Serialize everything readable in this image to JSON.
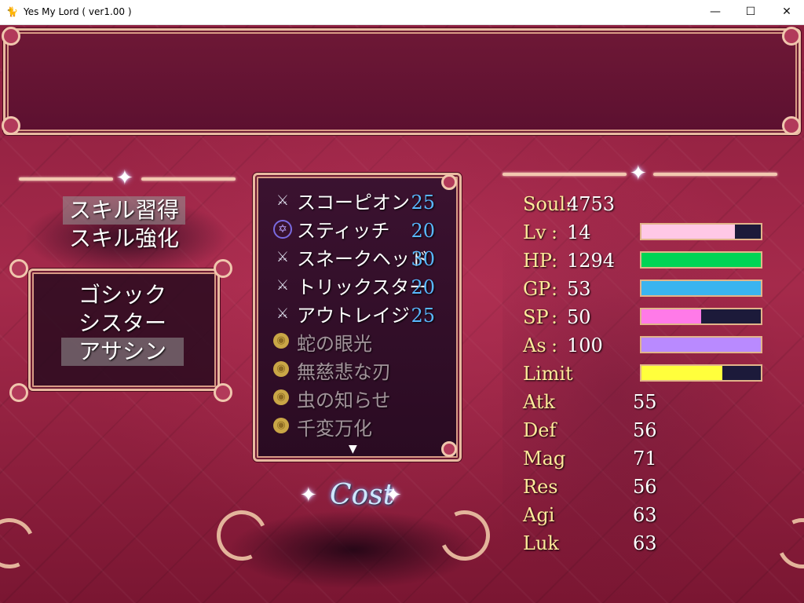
{
  "window": {
    "title": "Yes My Lord ( ver1.00 )",
    "icon": "app-icon",
    "minimize_glyph": "—",
    "maximize_glyph": "☐",
    "close_glyph": "✕"
  },
  "command_menu": {
    "items": [
      {
        "label": "スキル習得",
        "selected": true
      },
      {
        "label": "スキル強化",
        "selected": false
      }
    ]
  },
  "category_menu": {
    "items": [
      {
        "label": "ゴシック",
        "selected": false
      },
      {
        "label": "シスター",
        "selected": false
      },
      {
        "label": "アサシン",
        "selected": true
      }
    ]
  },
  "skills": [
    {
      "icon": "crossed-swords-icon",
      "name": "スコーピオン",
      "cost": "25",
      "enabled": true
    },
    {
      "icon": "hexagram-icon",
      "name": "スティッチ",
      "cost": "20",
      "enabled": true
    },
    {
      "icon": "crossed-swords-icon",
      "name": "スネークヘッド",
      "cost": "30",
      "enabled": true
    },
    {
      "icon": "crossed-swords-icon",
      "name": "トリックスター",
      "cost": "20",
      "enabled": true
    },
    {
      "icon": "crossed-swords-icon",
      "name": "アウトレイジ",
      "cost": "25",
      "enabled": true
    },
    {
      "icon": "gold-eye-icon",
      "name": "蛇の眼光",
      "cost": "",
      "enabled": false
    },
    {
      "icon": "gold-eye-icon",
      "name": "無慈悲な刃",
      "cost": "",
      "enabled": false
    },
    {
      "icon": "gold-eye-icon",
      "name": "虫の知らせ",
      "cost": "",
      "enabled": false
    },
    {
      "icon": "gold-eye-icon",
      "name": "千変万化",
      "cost": "",
      "enabled": false
    }
  ],
  "scroll_indicator": "▼",
  "cost_label": "Cost",
  "status": {
    "soul": {
      "label": "Soul",
      "sep": ":",
      "value": "4753"
    },
    "gauged": [
      {
        "label": "Lv",
        "sep": ":",
        "value": "14",
        "fill": 0.78,
        "color": "#ffc8e6"
      },
      {
        "label": "HP",
        "sep": ":",
        "value": "1294",
        "fill": 1.0,
        "color": "#00d455"
      },
      {
        "label": "GP",
        "sep": ":",
        "value": "53",
        "fill": 1.0,
        "color": "#3ab4f0"
      },
      {
        "label": "SP",
        "sep": ":",
        "value": "50",
        "fill": 0.5,
        "color": "#ff7ae8"
      },
      {
        "label": "As",
        "sep": ":",
        "value": "100",
        "fill": 1.0,
        "color": "#b98aff"
      },
      {
        "label": "Limit",
        "sep": "",
        "value": "",
        "fill": 0.68,
        "color": "#ffff3c"
      }
    ],
    "params": [
      {
        "label": "Atk",
        "value": "55"
      },
      {
        "label": "Def",
        "value": "56"
      },
      {
        "label": "Mag",
        "value": "71"
      },
      {
        "label": "Res",
        "value": "56"
      },
      {
        "label": "Agi",
        "value": "63"
      },
      {
        "label": "Luk",
        "value": "63"
      }
    ]
  },
  "colors": {
    "background": "#a52a4b",
    "frame": "#e9b9a0",
    "cost_blue": "#59b8ff",
    "stat_label": "#ffe99a"
  }
}
